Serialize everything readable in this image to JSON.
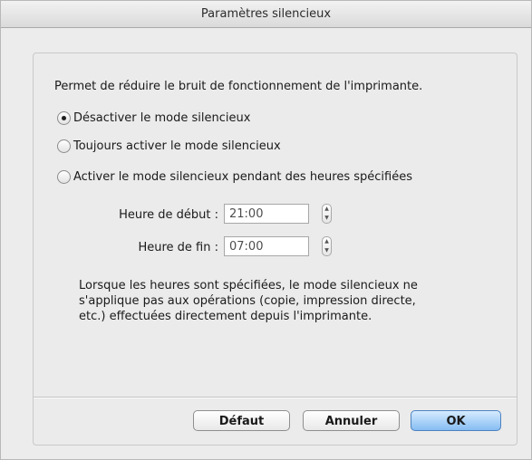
{
  "window": {
    "title": "Paramètres silencieux"
  },
  "dialog": {
    "description": "Permet de réduire le bruit de fonctionnement de l'imprimante.",
    "options": [
      {
        "label": "Désactiver le mode silencieux",
        "selected": true
      },
      {
        "label": "Toujours activer le mode silencieux",
        "selected": false
      },
      {
        "label": "Activer le mode silencieux pendant des heures spécifiées",
        "selected": false
      }
    ],
    "start_time": {
      "label": "Heure de début :",
      "value": "21:00"
    },
    "end_time": {
      "label": "Heure de fin :",
      "value": "07:00"
    },
    "note": "Lorsque les heures sont spécifiées, le mode silencieux ne\ns'applique pas aux opérations (copie, impression directe,\netc.) effectuées directement depuis l'imprimante."
  },
  "buttons": {
    "default_label": "Défaut",
    "cancel_label": "Annuler",
    "ok_label": "OK"
  },
  "icons": {
    "stepper_up": "▲",
    "stepper_down": "▼"
  },
  "colors": {
    "window_bg": "#ececec",
    "ok_button_accent": "#86bdf2"
  }
}
